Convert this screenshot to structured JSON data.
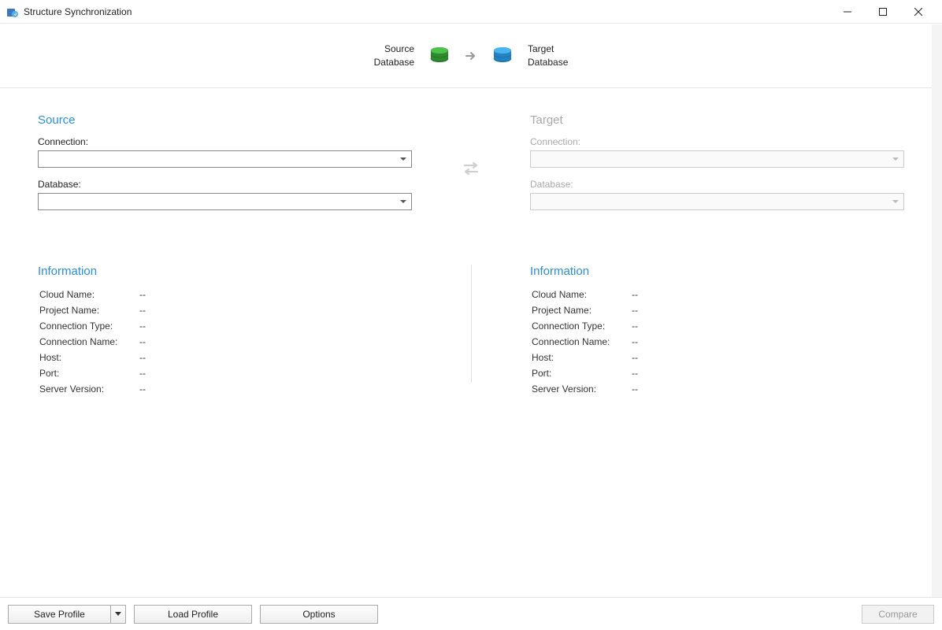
{
  "window": {
    "title": "Structure Synchronization"
  },
  "header": {
    "source_label_line1": "Source",
    "source_label_line2": "Database",
    "target_label_line1": "Target",
    "target_label_line2": "Database"
  },
  "source": {
    "title": "Source",
    "connection_label": "Connection:",
    "connection_value": "",
    "database_label": "Database:",
    "database_value": ""
  },
  "target": {
    "title": "Target",
    "connection_label": "Connection:",
    "connection_value": "",
    "database_label": "Database:",
    "database_value": ""
  },
  "info_labels": {
    "title": "Information",
    "cloud_name": "Cloud Name:",
    "project_name": "Project Name:",
    "connection_type": "Connection Type:",
    "connection_name": "Connection Name:",
    "host": "Host:",
    "port": "Port:",
    "server_version": "Server Version:"
  },
  "source_info": {
    "cloud_name": "--",
    "project_name": "--",
    "connection_type": "--",
    "connection_name": "--",
    "host": "--",
    "port": "--",
    "server_version": "--"
  },
  "target_info": {
    "cloud_name": "--",
    "project_name": "--",
    "connection_type": "--",
    "connection_name": "--",
    "host": "--",
    "port": "--",
    "server_version": "--"
  },
  "footer": {
    "save_profile": "Save Profile",
    "load_profile": "Load Profile",
    "options": "Options",
    "compare": "Compare"
  }
}
